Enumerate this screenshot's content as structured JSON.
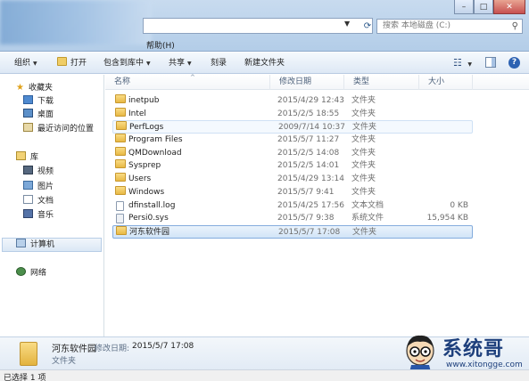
{
  "window": {
    "controls": {
      "minimize": "–",
      "maximize": "□",
      "close": "✕"
    },
    "refresh_icon": "refresh-icon",
    "search_placeholder": "搜索 本地磁盘 (C:)",
    "menu_help": "帮助(H)"
  },
  "toolbar": {
    "organize": "组织",
    "open": "打开",
    "include_in_library": "包含到库中",
    "share": "共享",
    "burn": "刻录",
    "new_folder": "新建文件夹"
  },
  "navpane": {
    "favorites": {
      "label": "收藏夹",
      "items": [
        "下载",
        "桌面",
        "最近访问的位置"
      ]
    },
    "libraries": {
      "label": "库",
      "items": [
        "视频",
        "图片",
        "文档",
        "音乐"
      ]
    },
    "computer": "计算机",
    "network": "网络"
  },
  "columns": {
    "name": "名称",
    "date": "修改日期",
    "type": "类型",
    "size": "大小"
  },
  "files": [
    {
      "name": "inetpub",
      "date": "2015/4/29 12:43",
      "type": "文件夹",
      "size": "",
      "icon": "folder"
    },
    {
      "name": "Intel",
      "date": "2015/2/5 18:55",
      "type": "文件夹",
      "size": "",
      "icon": "folder"
    },
    {
      "name": "PerfLogs",
      "date": "2009/7/14 10:37",
      "type": "文件夹",
      "size": "",
      "icon": "folder"
    },
    {
      "name": "Program Files",
      "date": "2015/5/7 11:27",
      "type": "文件夹",
      "size": "",
      "icon": "folder"
    },
    {
      "name": "QMDownload",
      "date": "2015/2/5 14:08",
      "type": "文件夹",
      "size": "",
      "icon": "folder"
    },
    {
      "name": "Sysprep",
      "date": "2015/2/5 14:01",
      "type": "文件夹",
      "size": "",
      "icon": "folder"
    },
    {
      "name": "Users",
      "date": "2015/4/29 13:14",
      "type": "文件夹",
      "size": "",
      "icon": "folder"
    },
    {
      "name": "Windows",
      "date": "2015/5/7 9:41",
      "type": "文件夹",
      "size": "",
      "icon": "folder"
    },
    {
      "name": "dfinstall.log",
      "date": "2015/4/25 17:56",
      "type": "文本文档",
      "size": "0 KB",
      "icon": "text-file"
    },
    {
      "name": "Persi0.sys",
      "date": "2015/5/7 9:38",
      "type": "系统文件",
      "size": "15,954 KB",
      "icon": "system-file"
    },
    {
      "name": "河东软件园",
      "date": "2015/5/7 17:08",
      "type": "文件夹",
      "size": "",
      "icon": "folder"
    }
  ],
  "details": {
    "name": "河东软件园",
    "date_label": "修改日期:",
    "date": "2015/5/7 17:08",
    "type": "文件夹"
  },
  "watermark": {
    "brand": "系统哥",
    "url": "www.xitongge.com"
  },
  "status": "已选择 1 项"
}
